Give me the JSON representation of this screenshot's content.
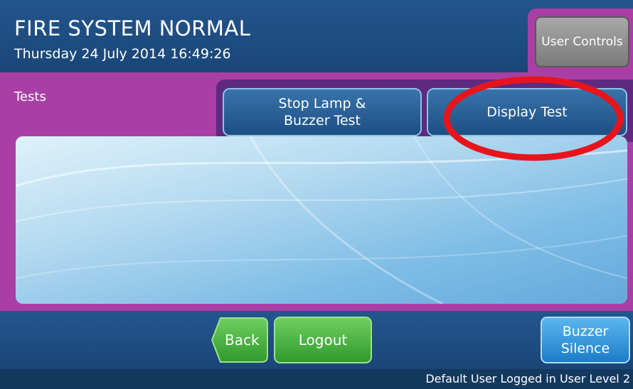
{
  "header": {
    "title": "FIRE SYSTEM NORMAL",
    "datetime": "Thursday 24 July 2014 16:49:26",
    "user_controls_label": "User Controls"
  },
  "panel": {
    "tab_label": "Tests",
    "buttons": {
      "stop_lamp": "Stop Lamp &\nBuzzer Test",
      "display_test": "Display Test"
    }
  },
  "footer": {
    "back_label": "Back",
    "logout_label": "Logout",
    "buzzer_label": "Buzzer\nSilence",
    "status": "Default User Logged in User Level 2"
  },
  "annotation": {
    "type": "red-ellipse",
    "color": "#e8141c",
    "target": "display-test-button"
  },
  "colors": {
    "header": "#1e4b7d",
    "panel": "#a93fa4",
    "logout": "#3aa535",
    "buzzer": "#2a8fd8"
  }
}
